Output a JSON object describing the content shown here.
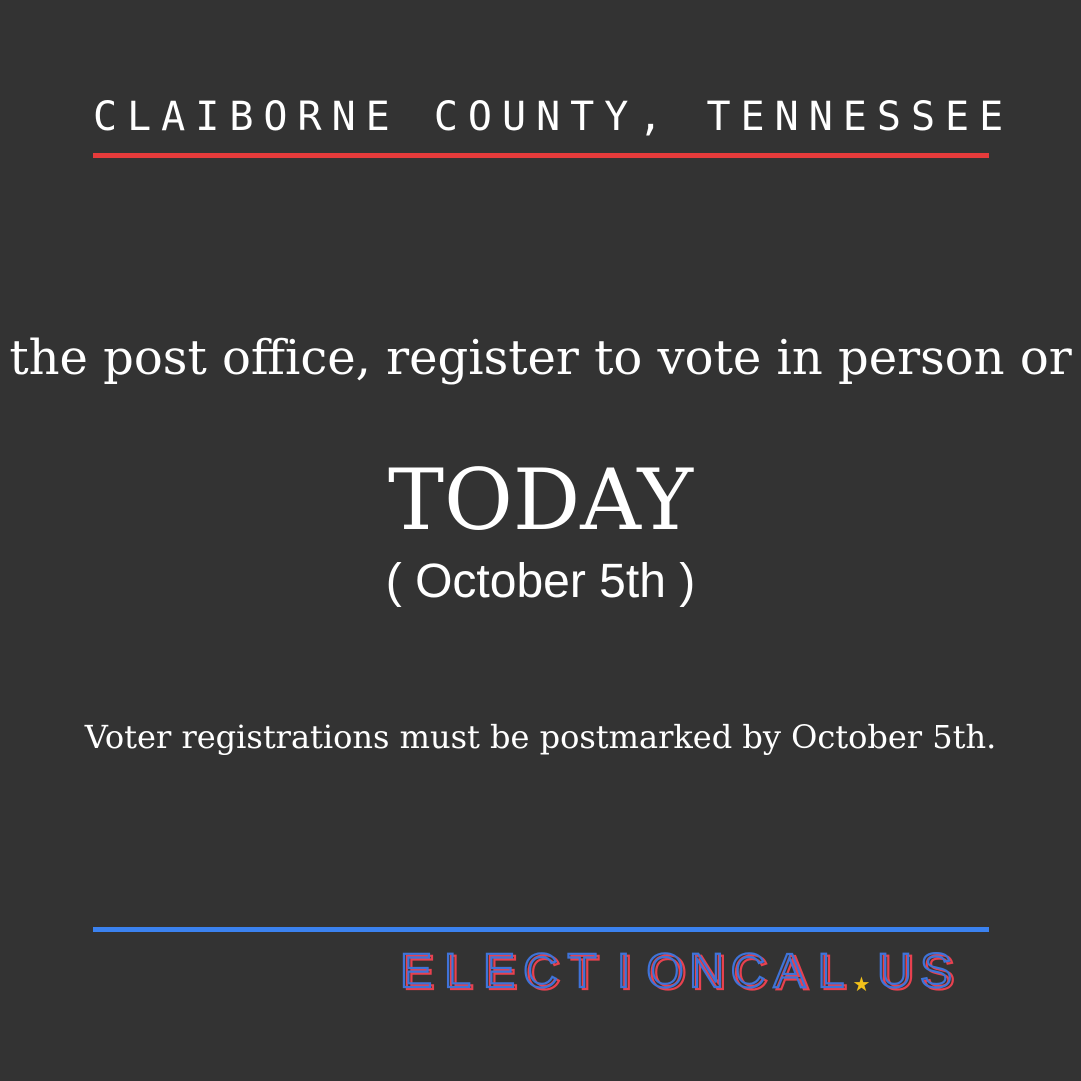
{
  "header": {
    "county": "CLAIBORNE COUNTY, TENNESSEE"
  },
  "main": {
    "headline": "the post office, register to vote in person or",
    "emphasis": "TODAY",
    "date": "( October 5th )",
    "note": "Voter registrations must be postmarked by October 5th."
  },
  "footer": {
    "brand": {
      "letters": [
        "E",
        "L",
        "E",
        "C",
        "T",
        "I",
        "O",
        "N",
        "C",
        "A",
        "L",
        ".",
        "U",
        "S"
      ],
      "star_icon": "star-icon"
    }
  },
  "colors": {
    "background": "#333333",
    "text": "#ffffff",
    "red_rule": "#e63b3b",
    "blue_rule": "#3b82f0",
    "brand_red": "#e8414f",
    "brand_blue": "#3f73d9",
    "star": "#f2c11a"
  }
}
